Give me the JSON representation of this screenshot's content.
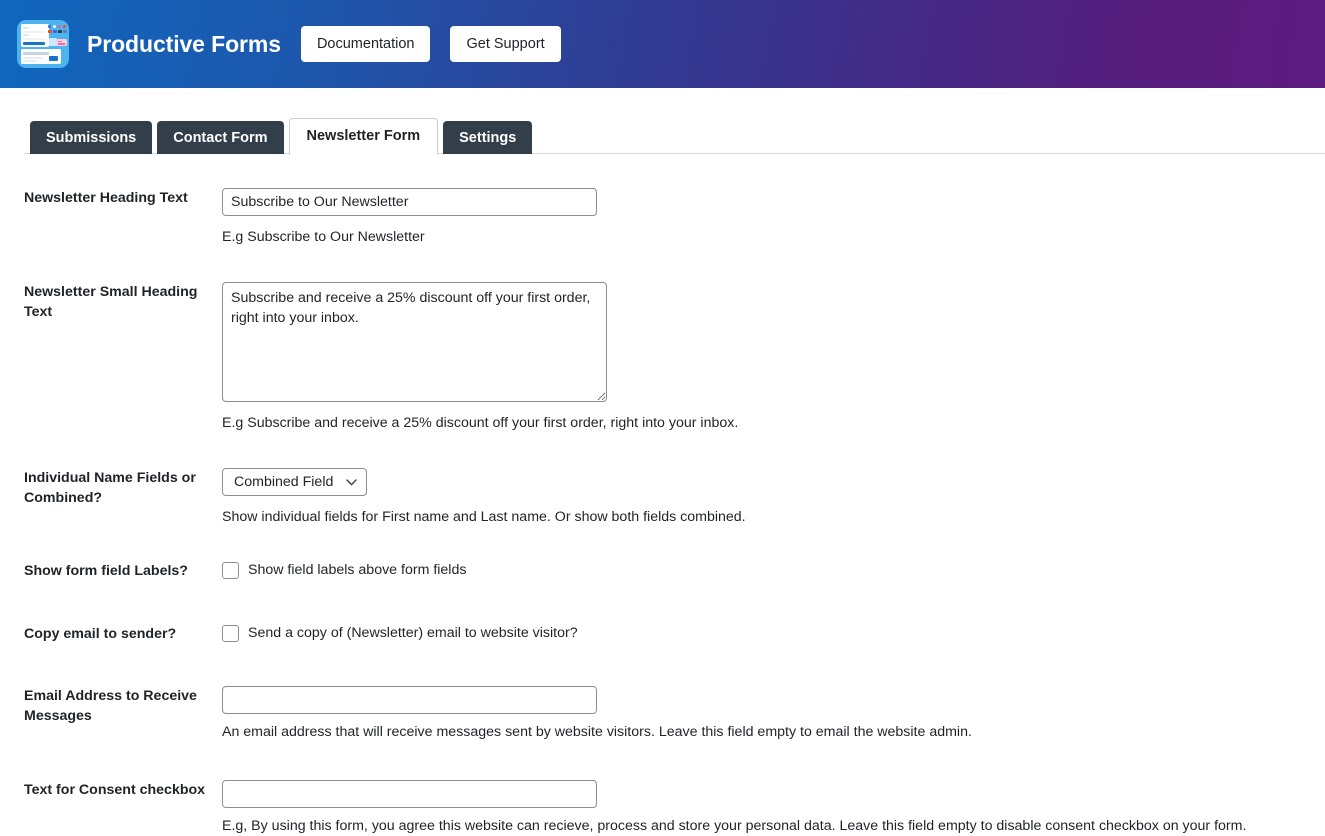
{
  "header": {
    "logo_icon": "productive-forms-logo-icon",
    "title": "Productive Forms",
    "buttons": [
      {
        "label": "Documentation"
      },
      {
        "label": "Get Support"
      }
    ],
    "gradient_start": "#0f66bd",
    "gradient_end": "#5d1b7f"
  },
  "tabs": [
    {
      "label": "Submissions",
      "active": false
    },
    {
      "label": "Contact Form",
      "active": false
    },
    {
      "label": "Newsletter Form",
      "active": true
    },
    {
      "label": "Settings",
      "active": false
    }
  ],
  "form": {
    "heading_text": {
      "label": "Newsletter Heading Text",
      "value": "Subscribe to Our Newsletter",
      "placeholder": "",
      "hint": "E.g Subscribe to Our Newsletter"
    },
    "small_heading_text": {
      "label": "Newsletter Small Heading Text",
      "value": "Subscribe and receive a 25% discount off your first order, right into your inbox.",
      "placeholder": "",
      "hint": "E.g Subscribe and receive a 25% discount off your first order, right into your inbox."
    },
    "name_fields": {
      "label": "Individual Name Fields or Combined?",
      "selected": "Combined Field",
      "chevron_icon": "chevron-down-icon",
      "hint": "Show individual fields for First name and Last name. Or show both fields combined."
    },
    "show_labels": {
      "label": "Show form field Labels?",
      "checkbox_label": "Show field labels above form fields",
      "checked": false
    },
    "copy_email": {
      "label": "Copy email to sender?",
      "checkbox_label": "Send a copy of (Newsletter) email to website visitor?",
      "checked": false
    },
    "receive_email": {
      "label": "Email Address to Receive Messages",
      "value": "",
      "placeholder": "",
      "hint": "An email address that will receive messages sent by website visitors. Leave this field empty to email the website admin."
    },
    "consent_text": {
      "label": "Text for Consent checkbox",
      "value": "",
      "placeholder": "",
      "hint": "E.g, By using this form, you agree this website can recieve, process and store your personal data. Leave this field empty to disable consent checkbox on your form."
    }
  }
}
